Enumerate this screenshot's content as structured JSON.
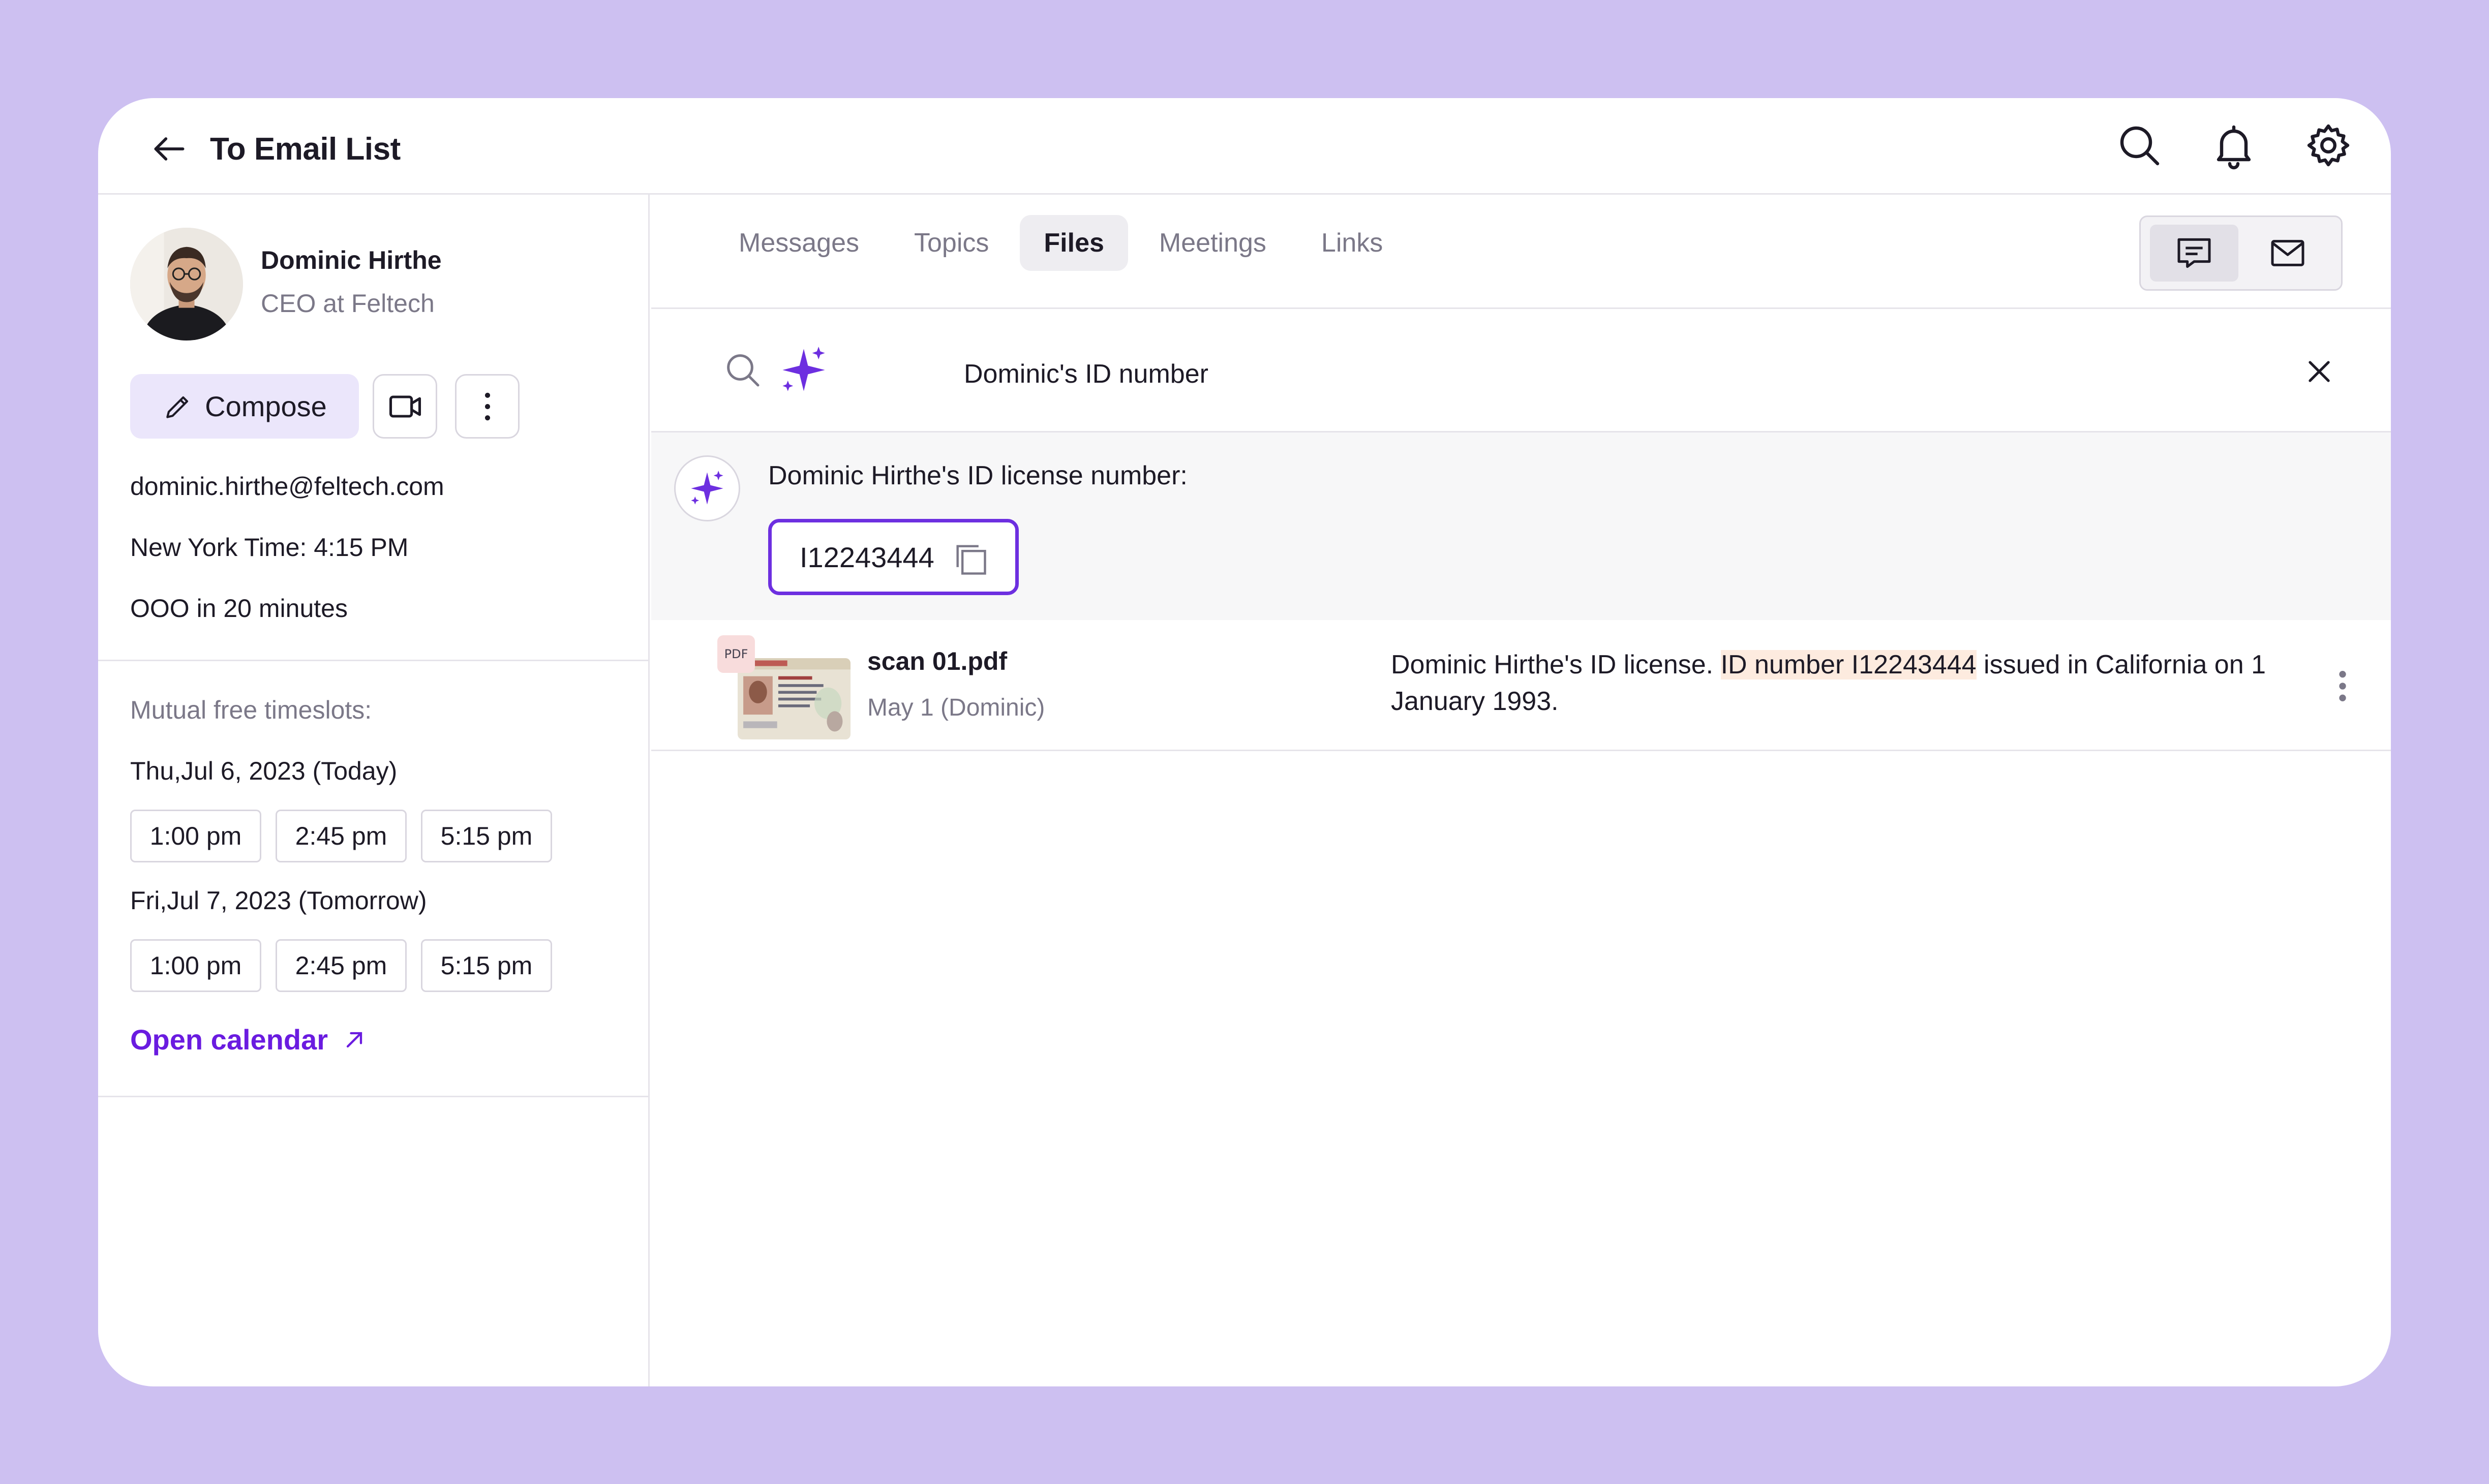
{
  "header": {
    "back_label": "To Email List",
    "icons": [
      "search-icon",
      "bell-icon",
      "gear-icon"
    ]
  },
  "contact": {
    "name": "Dominic Hirthe",
    "role": "CEO at Feltech",
    "email": "dominic.hirthe@feltech.com",
    "local_time": "New York Time: 4:15 PM",
    "status": "OOO in 20 minutes"
  },
  "actions": {
    "compose_label": "Compose"
  },
  "timeslots": {
    "heading": "Mutual free timeslots:",
    "days": [
      {
        "label": "Thu,Jul 6, 2023 (Today)",
        "slots": [
          "1:00 pm",
          "2:45 pm",
          "5:15 pm"
        ]
      },
      {
        "label": "Fri,Jul 7, 2023 (Tomorrow)",
        "slots": [
          "1:00 pm",
          "2:45 pm",
          "5:15 pm"
        ]
      }
    ],
    "open_calendar": "Open calendar"
  },
  "tabs": [
    {
      "label": "Messages",
      "active": false
    },
    {
      "label": "Topics",
      "active": false
    },
    {
      "label": "Files",
      "active": true
    },
    {
      "label": "Meetings",
      "active": false
    },
    {
      "label": "Links",
      "active": false
    }
  ],
  "search": {
    "query": "Dominic's ID number"
  },
  "ai_answer": {
    "title": "Dominic Hirthe's ID license number:",
    "value": "I12243444"
  },
  "files": [
    {
      "name": "scan 01.pdf",
      "meta": "May 1 (Dominic)",
      "badge": "PDF",
      "desc_before": "Dominic Hirthe's ID license. ",
      "desc_highlight": "ID number I12243444",
      "desc_after": " issued in California on 1 January 1993."
    }
  ],
  "colors": {
    "background": "#cdc0f1",
    "accent": "#6a1be0",
    "highlight": "#fdebdf",
    "compose_bg": "#ebe6fb"
  }
}
